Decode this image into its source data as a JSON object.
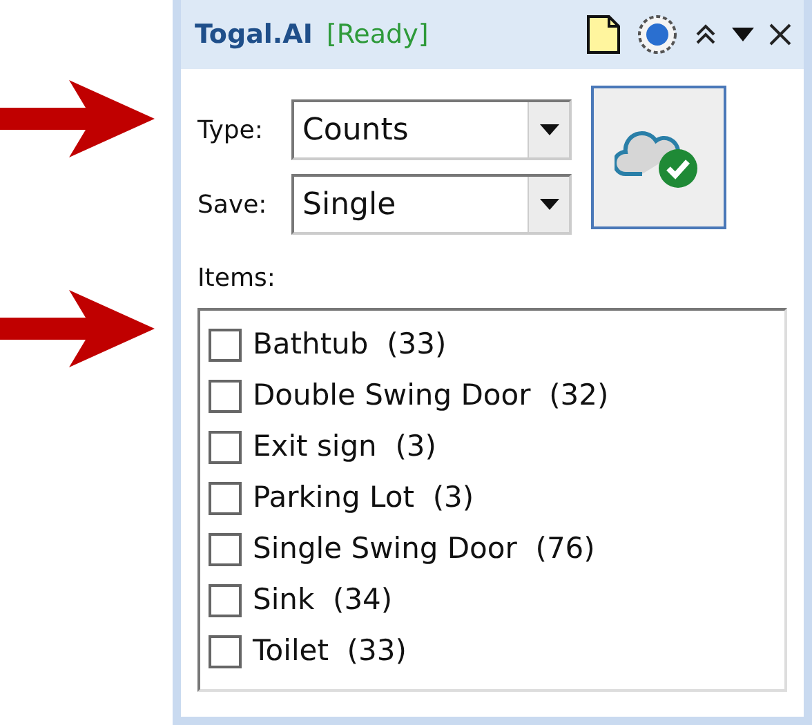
{
  "panel": {
    "title": "Togal.AI",
    "status": "[Ready]"
  },
  "fields": [
    {
      "label": "Type:",
      "value": "Counts"
    },
    {
      "label": "Save:",
      "value": "Single"
    }
  ],
  "items_label": "Items:",
  "items": [
    {
      "name": "Bathtub",
      "count": "(33)",
      "checked": false
    },
    {
      "name": "Double Swing Door",
      "count": "(32)",
      "checked": false
    },
    {
      "name": "Exit sign",
      "count": "(3)",
      "checked": false
    },
    {
      "name": "Parking Lot",
      "count": "(3)",
      "checked": false
    },
    {
      "name": "Single Swing Door",
      "count": "(76)",
      "checked": false
    },
    {
      "name": "Sink",
      "count": "(34)",
      "checked": false
    },
    {
      "name": "Toilet",
      "count": "(33)",
      "checked": false
    }
  ]
}
